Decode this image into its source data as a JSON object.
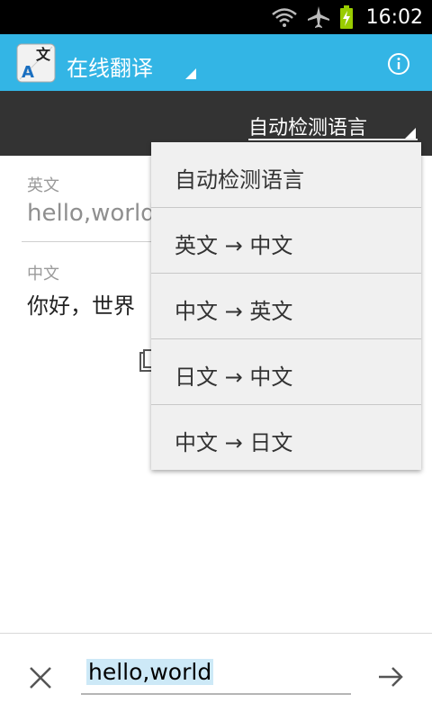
{
  "status_bar": {
    "time": "16:02",
    "icons": [
      "wifi-icon",
      "airplane-icon",
      "battery-charging-icon"
    ]
  },
  "app_bar": {
    "title": "在线翻译",
    "logo_icon": "translate-logo-icon",
    "info_icon": "info-icon"
  },
  "language_selector": {
    "selected": "自动检测语言",
    "options": [
      "自动检测语言",
      "英文 → 中文",
      "中文 → 英文",
      "日文 → 中文",
      "中文 → 日文"
    ]
  },
  "source": {
    "label": "英文",
    "text": "hello,world"
  },
  "result": {
    "label": "中文",
    "text": "你好，世界"
  },
  "input": {
    "value": "hello,world"
  },
  "colors": {
    "accent": "#33b5e5",
    "lang_bar": "#333333",
    "menu_bg": "#f0f0f0"
  }
}
